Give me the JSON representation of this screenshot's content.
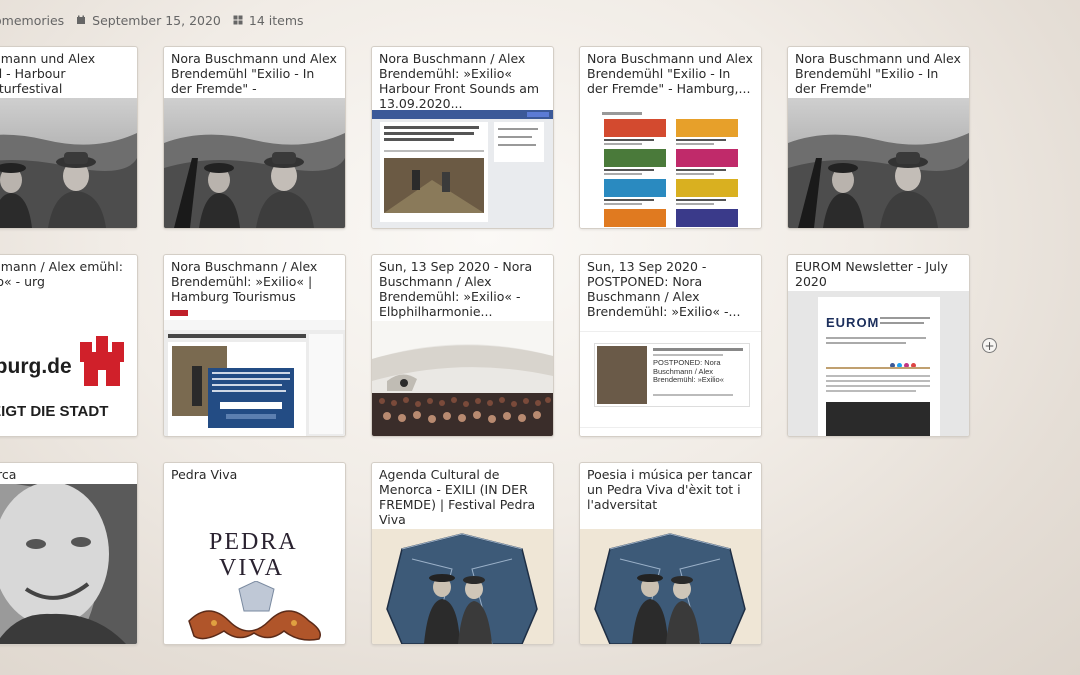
{
  "meta": {
    "category": "omemories",
    "date": "September 15, 2020",
    "count": "14 items"
  },
  "cards": [
    {
      "title": "Buschmann und Alex emühl - Harbour Literaturfestival",
      "thumb": "photo-duo"
    },
    {
      "title": "Nora Buschmann und Alex Brendemühl \"Exilio - In der Fremde\" - adLibrum.de",
      "thumb": "photo-duo"
    },
    {
      "title": "Nora Buschmann / Alex Brendemühl: »Exilio« Harbour Front Sounds am 13.09.2020...",
      "thumb": "facebook-event"
    },
    {
      "title": "Nora Buschmann und Alex Brendemühl \"Exilio - In der Fremde\" - Hamburg,...",
      "thumb": "event-listing"
    },
    {
      "title": "Nora Buschmann und Alex Brendemühl \"Exilio - In der Fremde\"",
      "thumb": "photo-duo"
    },
    {
      "title": "Buschmann / Alex emühl: »Exilio« - urg",
      "thumb": "hamburg-logo",
      "logo_text": "mburg.de",
      "slogan": "ZEIGT DIE STADT"
    },
    {
      "title": "Nora Buschmann / Alex Brendemühl: »Exilio« | Hamburg Tourismus",
      "thumb": "hamburg-site"
    },
    {
      "title": "Sun, 13 Sep 2020 - Nora Buschmann / Alex Brendemühl: »Exilio« - Elbphilharmonie...",
      "thumb": "concert-hall"
    },
    {
      "title": "Sun, 13 Sep 2020 - POSTPONED: Nora Buschmann / Alex Brendemühl: »Exilio« -...",
      "thumb": "whats-on",
      "event_text": "POSTPONED: Nora Buschmann / Alex Brendemühl: »Exilio«"
    },
    {
      "title": "EUROM Newsletter - July 2020",
      "thumb": "eurom",
      "logo_text": "EUROM"
    },
    {
      "title": "Menorca",
      "thumb": "portrait"
    },
    {
      "title": "Pedra Viva",
      "thumb": "pedra-logo",
      "logo_line1": "PEDRA",
      "logo_line2": "VIVA"
    },
    {
      "title": "Agenda Cultural de Menorca - EXILI (IN DER FREMDE) | Festival Pedra Viva",
      "thumb": "poster"
    },
    {
      "title": "Poesia i música per tancar un Pedra Viva d'èxit tot i l'adversitat",
      "thumb": "poster"
    }
  ],
  "colors": {
    "card_border": "#d4cec6",
    "meta_text": "#666666",
    "title_text": "#2a2a2a"
  }
}
